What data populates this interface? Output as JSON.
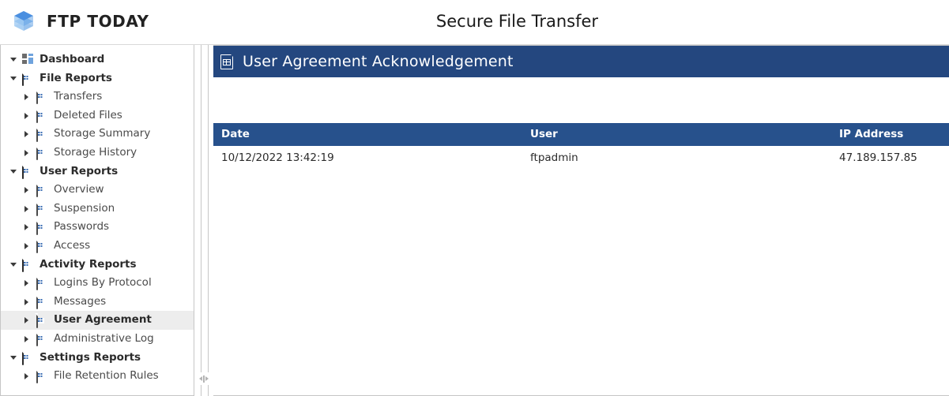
{
  "header": {
    "brand_name": "FTP TODAY",
    "logo_icon": "stacked-layers-logo",
    "app_title": "Secure File Transfer"
  },
  "sidebar": {
    "items": [
      {
        "label": "Dashboard",
        "icon": "dashboard-tiles-icon",
        "depth": 0,
        "expander": "down",
        "selected": false
      },
      {
        "label": "File Reports",
        "icon": "report-doc-icon",
        "depth": 0,
        "expander": "down",
        "selected": false
      },
      {
        "label": "Transfers",
        "icon": "report-doc-icon",
        "depth": 1,
        "expander": "right",
        "selected": false
      },
      {
        "label": "Deleted Files",
        "icon": "report-doc-icon",
        "depth": 1,
        "expander": "right",
        "selected": false
      },
      {
        "label": "Storage Summary",
        "icon": "report-doc-icon",
        "depth": 1,
        "expander": "right",
        "selected": false
      },
      {
        "label": "Storage History",
        "icon": "report-doc-icon",
        "depth": 1,
        "expander": "right",
        "selected": false
      },
      {
        "label": "User Reports",
        "icon": "report-doc-icon",
        "depth": 0,
        "expander": "down",
        "selected": false
      },
      {
        "label": "Overview",
        "icon": "report-doc-icon",
        "depth": 1,
        "expander": "right",
        "selected": false
      },
      {
        "label": "Suspension",
        "icon": "report-doc-icon",
        "depth": 1,
        "expander": "right",
        "selected": false
      },
      {
        "label": "Passwords",
        "icon": "report-doc-icon",
        "depth": 1,
        "expander": "right",
        "selected": false
      },
      {
        "label": "Access",
        "icon": "report-doc-icon",
        "depth": 1,
        "expander": "right",
        "selected": false
      },
      {
        "label": "Activity Reports",
        "icon": "report-doc-icon",
        "depth": 0,
        "expander": "down",
        "selected": false
      },
      {
        "label": "Logins By Protocol",
        "icon": "report-doc-icon",
        "depth": 1,
        "expander": "right",
        "selected": false
      },
      {
        "label": "Messages",
        "icon": "report-doc-icon",
        "depth": 1,
        "expander": "right",
        "selected": false
      },
      {
        "label": "User Agreement",
        "icon": "report-doc-icon",
        "depth": 1,
        "expander": "right",
        "selected": true
      },
      {
        "label": "Administrative Log",
        "icon": "report-doc-icon",
        "depth": 1,
        "expander": "right",
        "selected": false
      },
      {
        "label": "Settings Reports",
        "icon": "report-doc-icon",
        "depth": 0,
        "expander": "down",
        "selected": false
      },
      {
        "label": "File Retention Rules",
        "icon": "report-doc-icon",
        "depth": 1,
        "expander": "right",
        "selected": false
      }
    ]
  },
  "splitter": {
    "handle_icon": "collapse-expand-handle"
  },
  "panel": {
    "title": "User Agreement Acknowledgement",
    "title_icon": "report-doc-icon"
  },
  "table": {
    "columns": [
      "Date",
      "User",
      "IP Address"
    ],
    "rows": [
      [
        "10/12/2022 13:42:19",
        "ftpadmin",
        "47.189.157.85"
      ]
    ]
  },
  "colors": {
    "panel_title_bg": "#24477F",
    "table_header_bg": "#27518C",
    "selected_row_bg": "#EDEDED",
    "logo_blue": "#4A8FE0"
  }
}
